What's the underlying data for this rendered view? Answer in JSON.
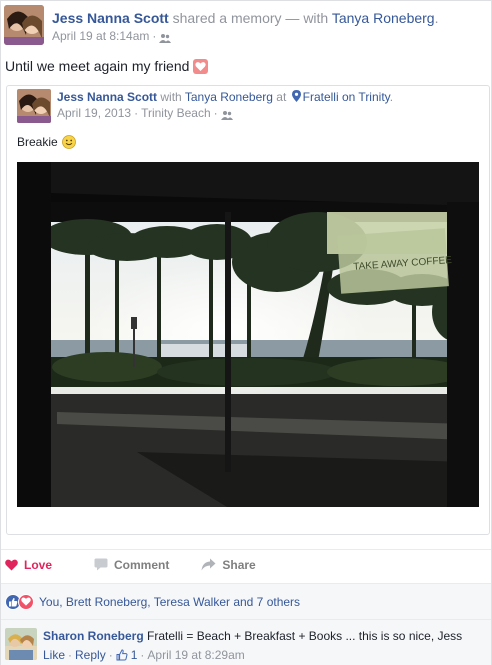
{
  "post": {
    "author": "Jess Nanna Scott",
    "action_text": "shared a memory — with",
    "with_name": "Tanya Roneberg",
    "with_suffix": ".",
    "timestamp": "April 19 at 8:14am",
    "dot": "·",
    "privacy_icon": "friends-icon",
    "status_text": "Until we meet again my friend",
    "status_emoji": "heart-emoji"
  },
  "memory": {
    "author": "Jess Nanna Scott",
    "with_label": "with",
    "with_name": "Tanya Roneberg",
    "at_label": "at",
    "place": "Fratelli on Trinity",
    "place_suffix": ".",
    "date": "April 19, 2013",
    "dot": "·",
    "location": "Trinity Beach",
    "dot2": "·",
    "caption": "Breakie",
    "caption_emoji": "smile-icon",
    "photo_sign_text": "TAKE AWAY COFFEE"
  },
  "actions": {
    "love": "Love",
    "comment": "Comment",
    "share": "Share"
  },
  "reactions": {
    "summary": "You, Brett Roneberg, Teresa Walker and 7 others"
  },
  "comment": {
    "author": "Sharon Roneberg",
    "text": "Fratelli = Beach + Breakfast + Books ... this is so nice, Jess",
    "like": "Like",
    "sep": "·",
    "reply": "Reply",
    "like_count": "1",
    "timestamp": "April 19 at 8:29am"
  },
  "colors": {
    "link": "#365899",
    "muted": "#90949c",
    "love": "#e0245e",
    "like_blue": "#4267b2"
  }
}
